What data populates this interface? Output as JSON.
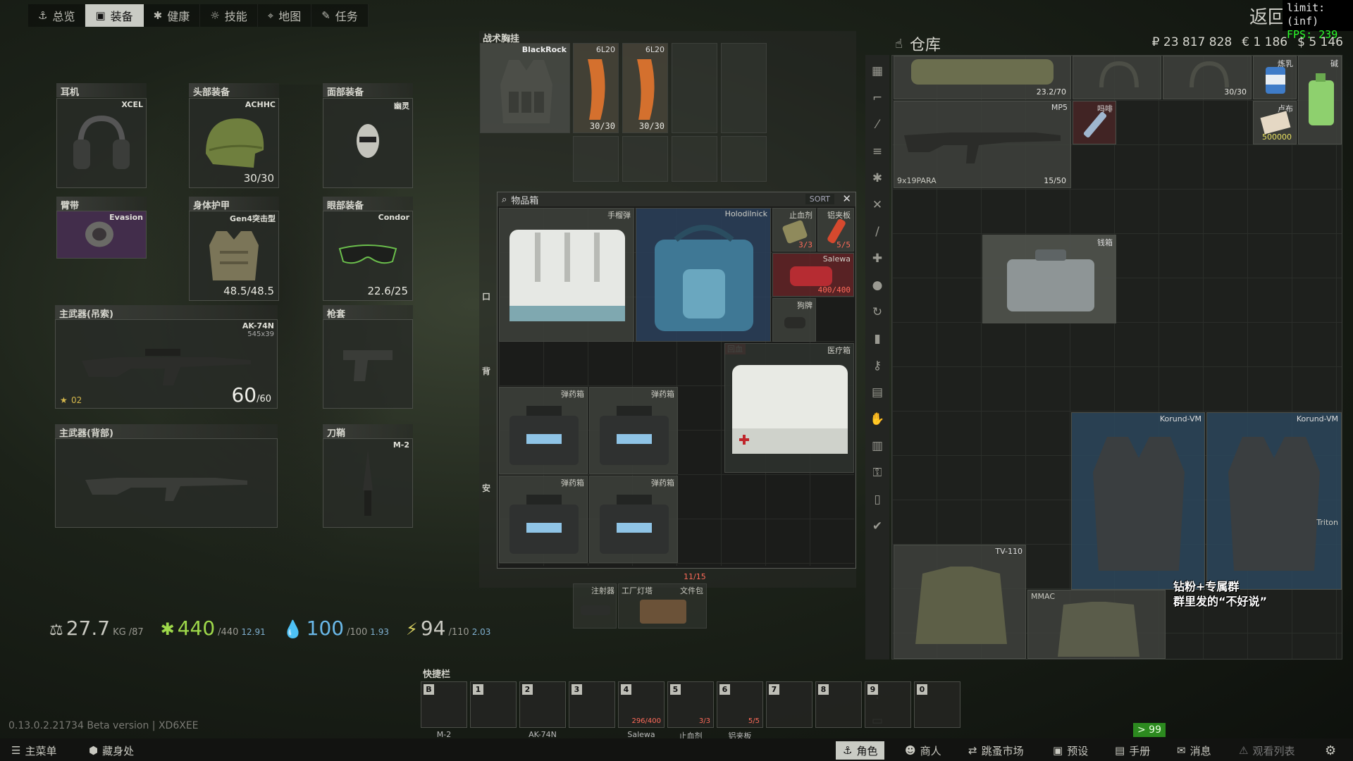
{
  "nav": {
    "tabs": [
      {
        "label": "总览",
        "icon": "anchor-icon"
      },
      {
        "label": "装备",
        "icon": "shirt-icon"
      },
      {
        "label": "健康",
        "icon": "medical-icon"
      },
      {
        "label": "技能",
        "icon": "skills-icon"
      },
      {
        "label": "地图",
        "icon": "map-pin-icon"
      },
      {
        "label": "任务",
        "icon": "tasks-icon"
      }
    ],
    "back_label": "返回"
  },
  "perf": {
    "limit": "limit: (inf)",
    "fps": "FPS: 239"
  },
  "equipment": {
    "earpiece": {
      "label": "耳机",
      "name": "XCEL"
    },
    "headwear": {
      "label": "头部装备",
      "name": "ACHHC",
      "durability": "30/30"
    },
    "face": {
      "label": "面部装备",
      "name": "幽灵"
    },
    "armband": {
      "label": "臂带",
      "name": "Evasion"
    },
    "armor": {
      "label": "身体护甲",
      "name": "Gen4突击型",
      "durability": "48.5/48.5"
    },
    "eyewear": {
      "label": "眼部装备",
      "name": "Condor",
      "durability": "22.6/25"
    },
    "primary_sling": {
      "label": "主武器(吊索)",
      "name": "AK-74N",
      "caliber": "545x39",
      "ammo": "60",
      "ammo_max": "/60",
      "level": "02"
    },
    "holster": {
      "label": "枪套"
    },
    "primary_back": {
      "label": "主武器(背部)"
    },
    "scabbard": {
      "label": "刀鞘",
      "name": "M-2"
    }
  },
  "stats": {
    "weight": "27.7",
    "weight_unit": "KG",
    "weight_max": "/87",
    "health": "440",
    "health_max": "/440",
    "health_regen": "12.91",
    "hydration": "100",
    "hydration_max": "/100",
    "hydration_regen": "1.93",
    "energy": "94",
    "energy_max": "/110",
    "energy_regen": "2.03"
  },
  "rig": {
    "label": "战术胸挂",
    "name": "BlackRock",
    "mags": [
      {
        "caliber": "6L20",
        "ammo": "30/30"
      },
      {
        "caliber": "6L20",
        "ammo": "30/30"
      }
    ],
    "side_labels": [
      "口",
      "背",
      "安"
    ]
  },
  "item_case": {
    "title": "物品箱",
    "sort_label": "SORT",
    "items": {
      "grenade_case": {
        "name": "手榴弹"
      },
      "holodilnick": {
        "name": "Holodilnick"
      },
      "hemostat": {
        "name": "止血剂",
        "count": "3/3"
      },
      "splint": {
        "name": "铝夹板",
        "count": "5/5"
      },
      "salewa": {
        "name": "Salewa",
        "count": "400/400"
      },
      "dogtag": {
        "name": "狗牌"
      },
      "regen_tag": {
        "name": "回血"
      },
      "medcase": {
        "name": "医疗箱"
      },
      "ammo1": {
        "name": "弹药箱"
      },
      "ammo2": {
        "name": "弹药箱"
      },
      "ammo3": {
        "name": "弹药箱"
      },
      "ammo4": {
        "name": "弹药箱"
      }
    },
    "below": {
      "count": "11/15",
      "injector": "注射器",
      "toolkit": "工厂灯塔",
      "docs": "文件包"
    }
  },
  "stash": {
    "title": "仓库",
    "money": {
      "rub": "₽ 23 817 828",
      "eur": "€ 1 186",
      "usd": "$ 5 146"
    },
    "items": {
      "gun1_ammo": "23.2/70",
      "headset_cnt": "30/30",
      "cond_milk": "炼乳",
      "detergent": "碱",
      "mp5": {
        "name": "MP5",
        "ammo_type": "9x19PARA",
        "ammo": "15/50"
      },
      "morphine": "吗啡",
      "roubles": {
        "name": "卢布",
        "count": "500000"
      },
      "money_case": "钱箱",
      "korund1": "Korund-VM",
      "korund2": "Korund-VM",
      "tv110": "TV-110",
      "triton": "Triton",
      "mmac": "MMAC"
    },
    "overlay_line1": "钻粉+专属群",
    "overlay_line2": "群里发的“不好说”"
  },
  "hotbar": {
    "label": "快捷栏",
    "slots": [
      {
        "key": "B",
        "name": "M-2"
      },
      {
        "key": "1",
        "name": ""
      },
      {
        "key": "2",
        "name": "AK-74N"
      },
      {
        "key": "3",
        "name": ""
      },
      {
        "key": "4",
        "name": "Salewa",
        "count": "296/400"
      },
      {
        "key": "5",
        "name": "止血剂",
        "count": "3/3"
      },
      {
        "key": "6",
        "name": "铝夹板",
        "count": "5/5"
      },
      {
        "key": "7",
        "name": ""
      },
      {
        "key": "8",
        "name": ""
      },
      {
        "key": "9",
        "name": ""
      },
      {
        "key": "0",
        "name": ""
      }
    ]
  },
  "version": "0.13.0.2.21734 Beta version | XD6XEE",
  "badge": "> 99",
  "bottom": {
    "main_menu": "主菜单",
    "hideout": "藏身处",
    "character": "角色",
    "traders": "商人",
    "flea": "跳蚤市场",
    "presets": "预设",
    "handbook": "手册",
    "messages": "消息",
    "watchlist": "观看列表"
  }
}
